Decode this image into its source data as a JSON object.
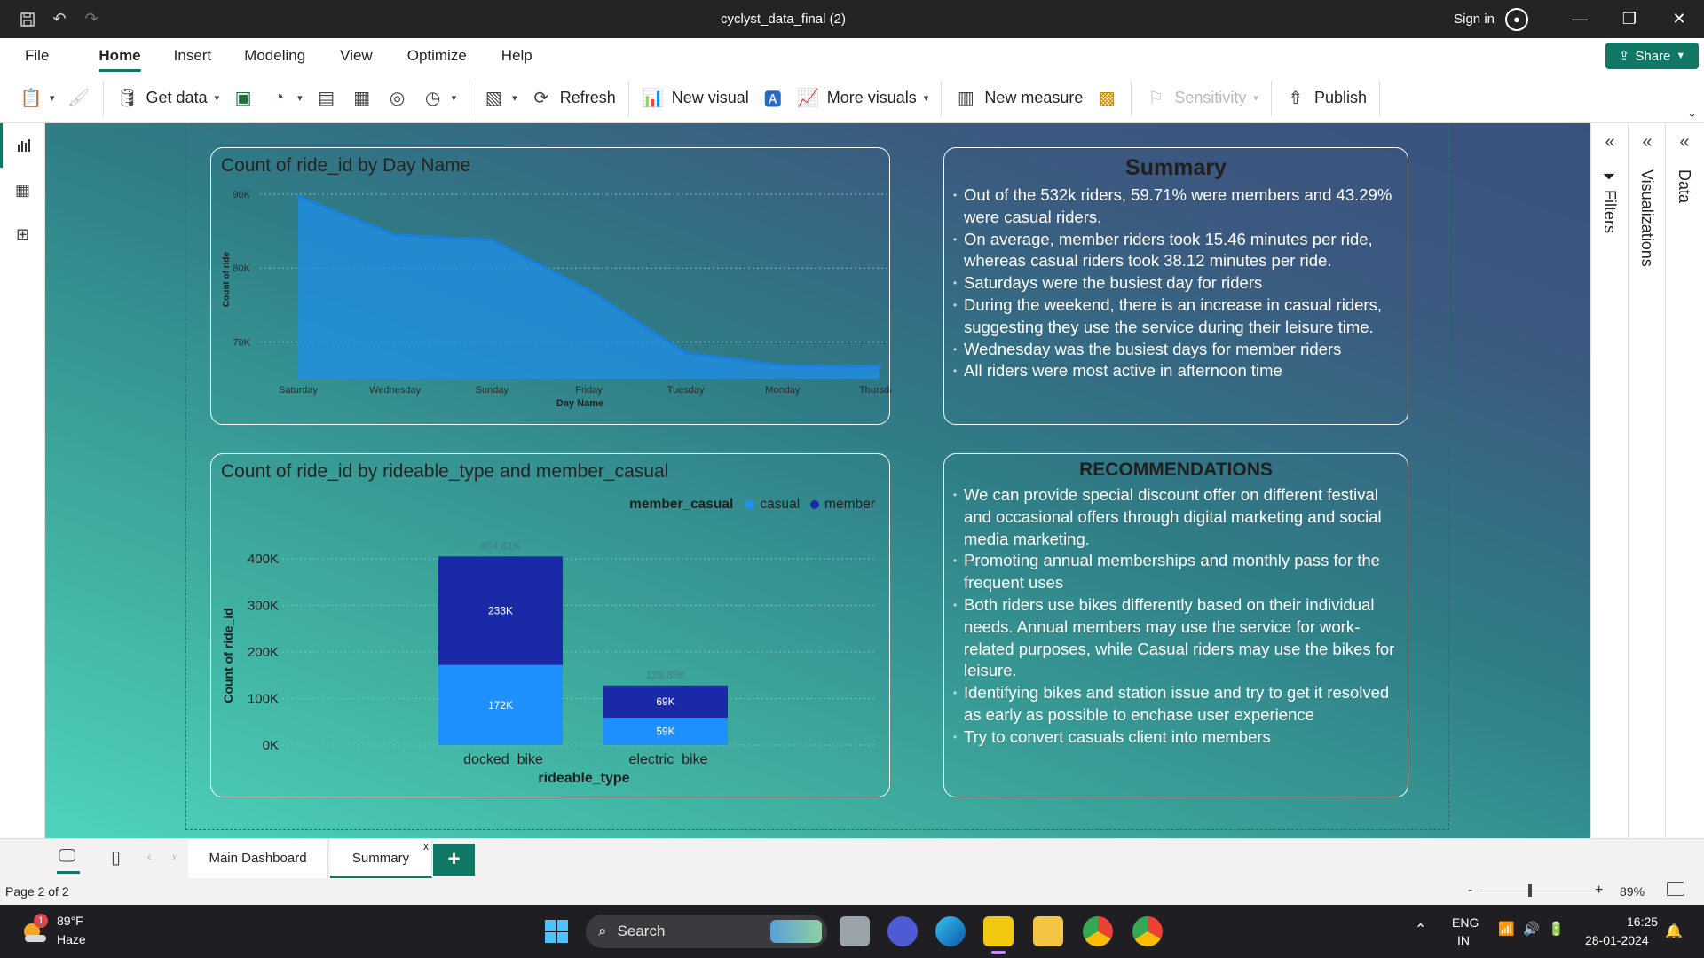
{
  "window": {
    "title": "cyclyst_data_final (2)",
    "sign_in": "Sign in",
    "minimize": "—",
    "maximize": "❐",
    "close": "✕"
  },
  "menu": {
    "items": [
      "File",
      "Home",
      "Insert",
      "Modeling",
      "View",
      "Optimize",
      "Help"
    ],
    "active": "Home",
    "share_label": "Share"
  },
  "ribbon": {
    "get_data": "Get data",
    "refresh": "Refresh",
    "new_visual": "New visual",
    "more_visuals": "More visuals",
    "new_measure": "New measure",
    "sensitivity": "Sensitivity",
    "publish": "Publish"
  },
  "panes": {
    "filters": "Filters",
    "visualizations": "Visualizations",
    "data": "Data"
  },
  "line_chart": {
    "title": "Count of ride_id by Day Name",
    "xlabel": "Day Name",
    "ylabel": "Count of ride",
    "y_ticks": [
      "90K",
      "80K",
      "70K"
    ]
  },
  "bar_chart": {
    "title": "Count of ride_id by rideable_type and member_casual",
    "legend_title": "member_casual",
    "xlabel": "rideable_type",
    "ylabel": "Count of ride_id",
    "y_ticks": [
      "400K",
      "300K",
      "200K",
      "100K",
      "0K"
    ],
    "totals": [
      "404.61K",
      "128.35K"
    ],
    "member_labels": [
      "233K",
      "69K"
    ],
    "casual_labels": [
      "172K",
      "59K"
    ]
  },
  "chart_data": [
    {
      "type": "area",
      "title": "Count of ride_id by Day Name",
      "xlabel": "Day Name",
      "ylabel": "Count of ride",
      "categories": [
        "Saturday",
        "Wednesday",
        "Sunday",
        "Friday",
        "Tuesday",
        "Monday",
        "Thursday"
      ],
      "values": [
        89700,
        84500,
        83800,
        77000,
        68500,
        66800,
        66700
      ],
      "ylim": [
        65000,
        90000
      ],
      "grid": true,
      "colors": {
        "fill": "#1f8fe8",
        "line": "#1a7fe0"
      }
    },
    {
      "type": "bar",
      "stacked": true,
      "title": "Count of ride_id by rideable_type and member_casual",
      "xlabel": "rideable_type",
      "ylabel": "Count of ride_id",
      "categories": [
        "docked_bike",
        "electric_bike"
      ],
      "series": [
        {
          "name": "casual",
          "values": [
            172000,
            59000
          ],
          "color": "#1e90ff"
        },
        {
          "name": "member",
          "values": [
            233000,
            69000
          ],
          "color": "#1a2aa6"
        }
      ],
      "ylim": [
        0,
        400000
      ],
      "legend": "top-right",
      "grid": true
    }
  ],
  "summary": {
    "heading": "Summary",
    "bullets": [
      "Out of the 532k riders, 59.71% were members and 43.29% were casual riders.",
      "On average, member riders took 15.46 minutes per ride, whereas casual riders took 38.12 minutes per ride.",
      "Saturdays were the busiest day for riders",
      "During the weekend, there is an increase in casual riders, suggesting they use the service during their leisure time.",
      "Wednesday was the busiest days for member riders",
      "All riders were most active in afternoon time"
    ]
  },
  "recommendations": {
    "heading": "RECOMMENDATIONS",
    "bullets": [
      "We can provide special discount offer on different festival and occasional offers through digital marketing and social media marketing.",
      "Promoting annual memberships and monthly pass for the frequent uses",
      "Both riders use bikes differently based on their individual needs. Annual members may use the service for work-related purposes, while Casual riders may use the bikes for leisure.",
      "Identifying bikes and station issue and try to get it resolved as early as possible to enchase user experience",
      "Try to convert casuals client into members"
    ]
  },
  "tabs": {
    "main": "Main Dashboard",
    "summary": "Summary",
    "add": "+",
    "close": "x"
  },
  "status": {
    "page": "Page 2 of 2",
    "zoom": "89%",
    "zoom_minus": "-",
    "zoom_plus": "+"
  },
  "taskbar": {
    "weather_temp": "89°F",
    "weather_desc": "Haze",
    "weather_badge": "1",
    "search": "Search",
    "lang": "ENG",
    "region": "IN",
    "time": "16:25",
    "date": "28-01-2024"
  }
}
